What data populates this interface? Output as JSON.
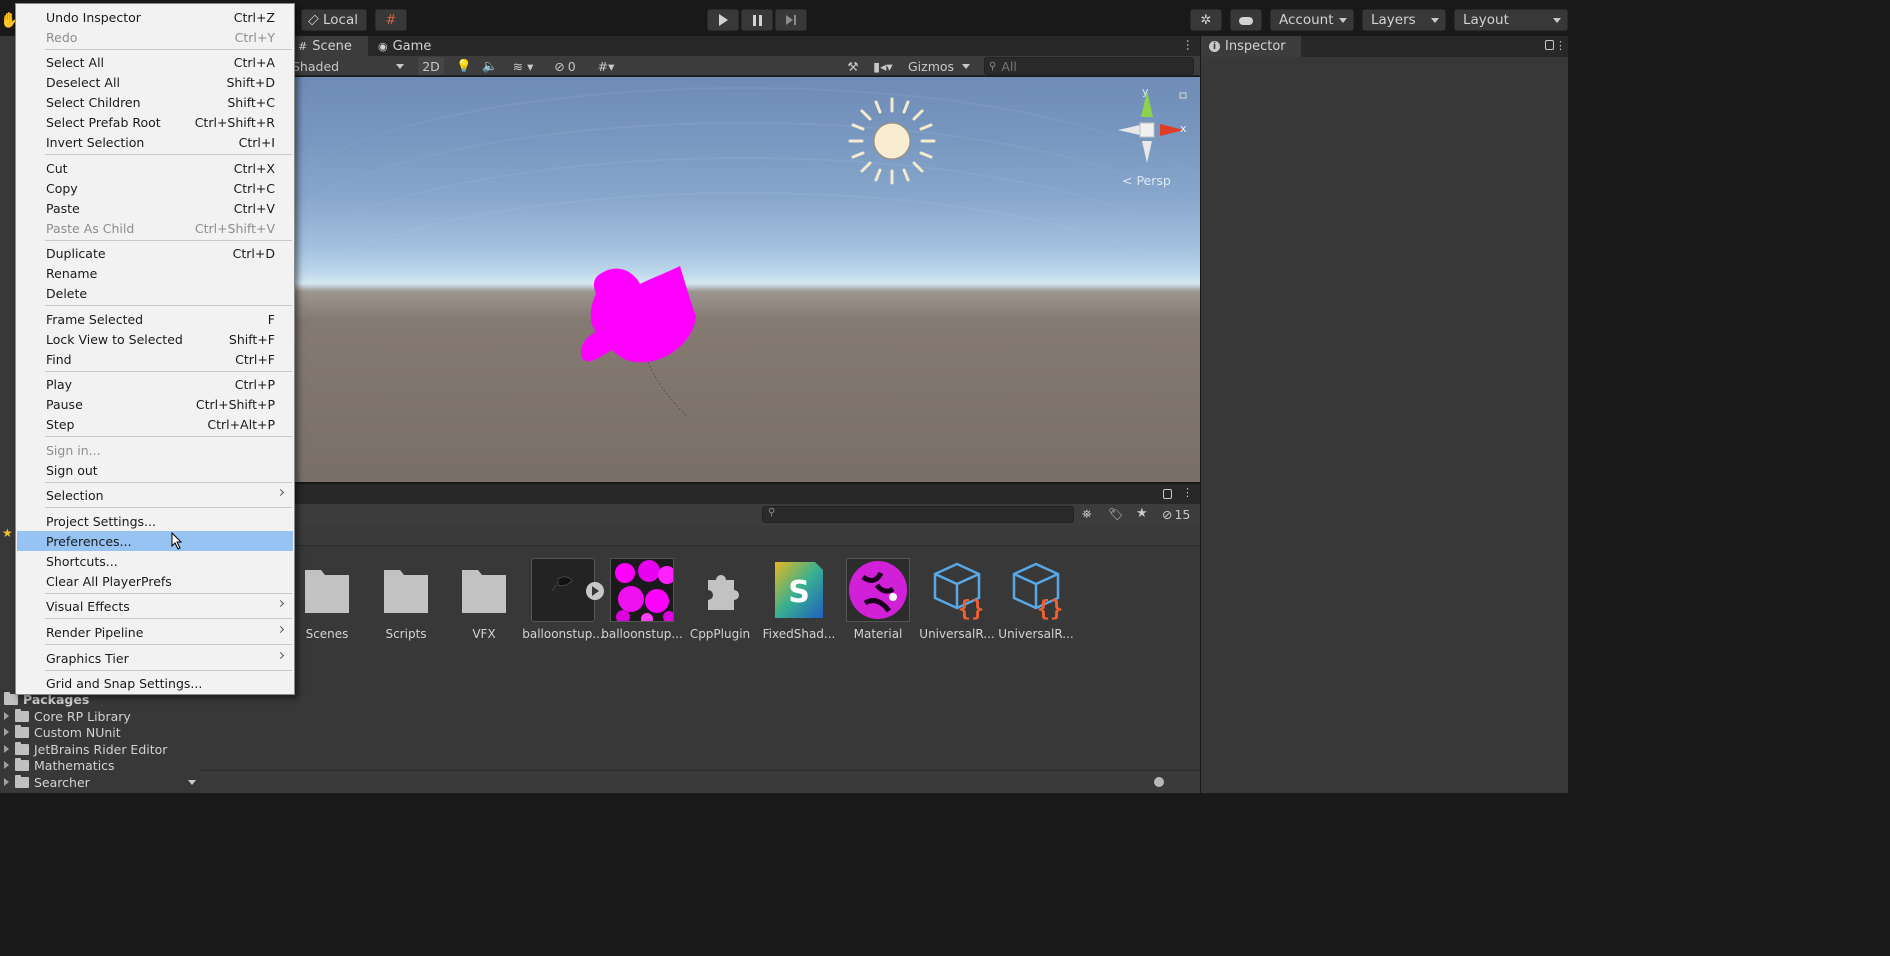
{
  "toolbar": {
    "pivot_label": "Local",
    "account_label": "Account",
    "layers_label": "Layers",
    "layout_label": "Layout"
  },
  "scene_tabs": {
    "scene_label": "Scene",
    "game_label": "Game"
  },
  "scene_toolbar": {
    "shading_label": "Shaded",
    "mode_2d_label": "2D",
    "hidden_count": "0",
    "gizmos_label": "Gizmos",
    "search_placeholder": "All"
  },
  "viewport": {
    "axis_y": "y",
    "axis_x": "x",
    "projection_label": "< Persp"
  },
  "inspector": {
    "tab_label": "Inspector"
  },
  "project": {
    "hidden_count": "15",
    "assets": [
      {
        "label": "Scenes",
        "icon": "folder-icon"
      },
      {
        "label": "Scripts",
        "icon": "folder-icon"
      },
      {
        "label": "VFX",
        "icon": "folder-icon"
      },
      {
        "label": "balloonstup...",
        "icon": "model-icon"
      },
      {
        "label": "balloonstup...",
        "icon": "texture-icon"
      },
      {
        "label": "CppPlugin",
        "icon": "plugin-icon"
      },
      {
        "label": "FixedShad...",
        "icon": "shader-graph-icon"
      },
      {
        "label": "Material",
        "icon": "material-icon"
      },
      {
        "label": "UniversalR...",
        "icon": "asset-icon"
      },
      {
        "label": "UniversalR...",
        "icon": "asset-icon"
      }
    ],
    "tree": {
      "packages_label": "Packages",
      "items": [
        "Core RP Library",
        "Custom NUnit",
        "JetBrains Rider Editor",
        "Mathematics",
        "Searcher"
      ]
    }
  },
  "edit_menu": {
    "items": [
      {
        "label": "Undo Inspector",
        "shortcut": "Ctrl+Z"
      },
      {
        "label": "Redo",
        "shortcut": "Ctrl+Y"
      },
      {
        "label": "Select All",
        "shortcut": "Ctrl+A"
      },
      {
        "label": "Deselect All",
        "shortcut": "Shift+D"
      },
      {
        "label": "Select Children",
        "shortcut": "Shift+C"
      },
      {
        "label": "Select Prefab Root",
        "shortcut": "Ctrl+Shift+R"
      },
      {
        "label": "Invert Selection",
        "shortcut": "Ctrl+I"
      },
      {
        "label": "Cut",
        "shortcut": "Ctrl+X"
      },
      {
        "label": "Copy",
        "shortcut": "Ctrl+C"
      },
      {
        "label": "Paste",
        "shortcut": "Ctrl+V"
      },
      {
        "label": "Paste As Child",
        "shortcut": "Ctrl+Shift+V"
      },
      {
        "label": "Duplicate",
        "shortcut": "Ctrl+D"
      },
      {
        "label": "Rename",
        "shortcut": ""
      },
      {
        "label": "Delete",
        "shortcut": ""
      },
      {
        "label": "Frame Selected",
        "shortcut": "F"
      },
      {
        "label": "Lock View to Selected",
        "shortcut": "Shift+F"
      },
      {
        "label": "Find",
        "shortcut": "Ctrl+F"
      },
      {
        "label": "Play",
        "shortcut": "Ctrl+P"
      },
      {
        "label": "Pause",
        "shortcut": "Ctrl+Shift+P"
      },
      {
        "label": "Step",
        "shortcut": "Ctrl+Alt+P"
      },
      {
        "label": "Sign in...",
        "shortcut": ""
      },
      {
        "label": "Sign out",
        "shortcut": ""
      },
      {
        "label": "Selection",
        "shortcut": ""
      },
      {
        "label": "Project Settings...",
        "shortcut": ""
      },
      {
        "label": "Preferences...",
        "shortcut": ""
      },
      {
        "label": "Shortcuts...",
        "shortcut": ""
      },
      {
        "label": "Clear All PlayerPrefs",
        "shortcut": ""
      },
      {
        "label": "Visual Effects",
        "shortcut": ""
      },
      {
        "label": "Render Pipeline",
        "shortcut": ""
      },
      {
        "label": "Graphics Tier",
        "shortcut": ""
      },
      {
        "label": "Grid and Snap Settings...",
        "shortcut": ""
      }
    ]
  },
  "colors": {
    "menu_highlight": "#96c3f2",
    "missing_material": "#ff00ff",
    "play_accent": "#d2d2d2"
  }
}
